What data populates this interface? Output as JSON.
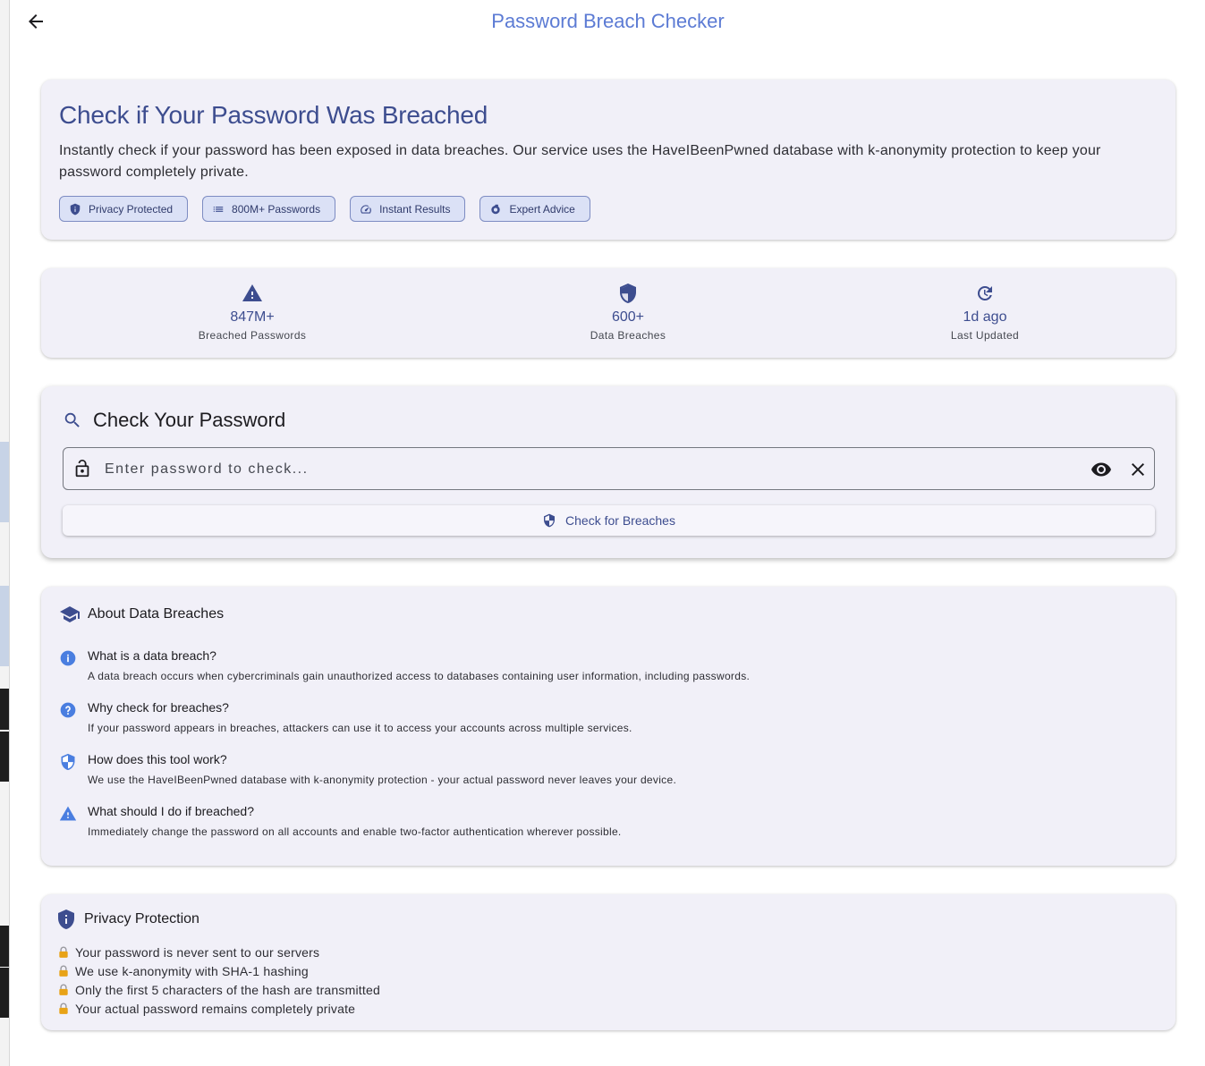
{
  "app": {
    "title": "Password Breach Checker"
  },
  "hero": {
    "title": "Check if Your Password Was Breached",
    "description": "Instantly check if your password has been exposed in data breaches. Our service uses the HaveIBeenPwned database with k-anonymity protection to keep your password completely private.",
    "chips": [
      {
        "label": "Privacy Protected",
        "icon": "shield-icon"
      },
      {
        "label": "800M+ Passwords",
        "icon": "list-icon"
      },
      {
        "label": "Instant Results",
        "icon": "speed-icon"
      },
      {
        "label": "Expert Advice",
        "icon": "advice-icon"
      }
    ]
  },
  "stats": [
    {
      "value": "847M+",
      "label": "Breached Passwords",
      "icon": "warning-icon"
    },
    {
      "value": "600+",
      "label": "Data Breaches",
      "icon": "shield-icon"
    },
    {
      "value": "1d ago",
      "label": "Last Updated",
      "icon": "refresh-icon"
    }
  ],
  "check": {
    "title": "Check Your Password",
    "input_value": "",
    "input_placeholder": "Enter password to check...",
    "button_label": "Check for Breaches"
  },
  "about": {
    "title": "About Data Breaches",
    "items": [
      {
        "question": "What is a data breach?",
        "answer": "A data breach occurs when cybercriminals gain unauthorized access to databases containing user information, including passwords.",
        "icon": "info-icon"
      },
      {
        "question": "Why check for breaches?",
        "answer": "If your password appears in breaches, attackers can use it to access your accounts across multiple services.",
        "icon": "help-icon"
      },
      {
        "question": "How does this tool work?",
        "answer": "We use the HaveIBeenPwned database with k-anonymity protection - your actual password never leaves your device.",
        "icon": "shield-icon"
      },
      {
        "question": "What should I do if breached?",
        "answer": "Immediately change the password on all accounts and enable two-factor authentication wherever possible.",
        "icon": "warning-icon"
      }
    ]
  },
  "privacy": {
    "title": "Privacy Protection",
    "items": [
      "Your password is never sent to our servers",
      "We use k-anonymity with SHA-1 hashing",
      "Only the first 5 characters of the hash are transmitted",
      "Your actual password remains completely private"
    ]
  },
  "colors": {
    "accent": "#5c7bd4",
    "primary": "#3d4d8f",
    "card_bg": "#f1f0f8",
    "chip_bg": "#dbe1f6",
    "icon_blue": "#4a7ee0"
  }
}
